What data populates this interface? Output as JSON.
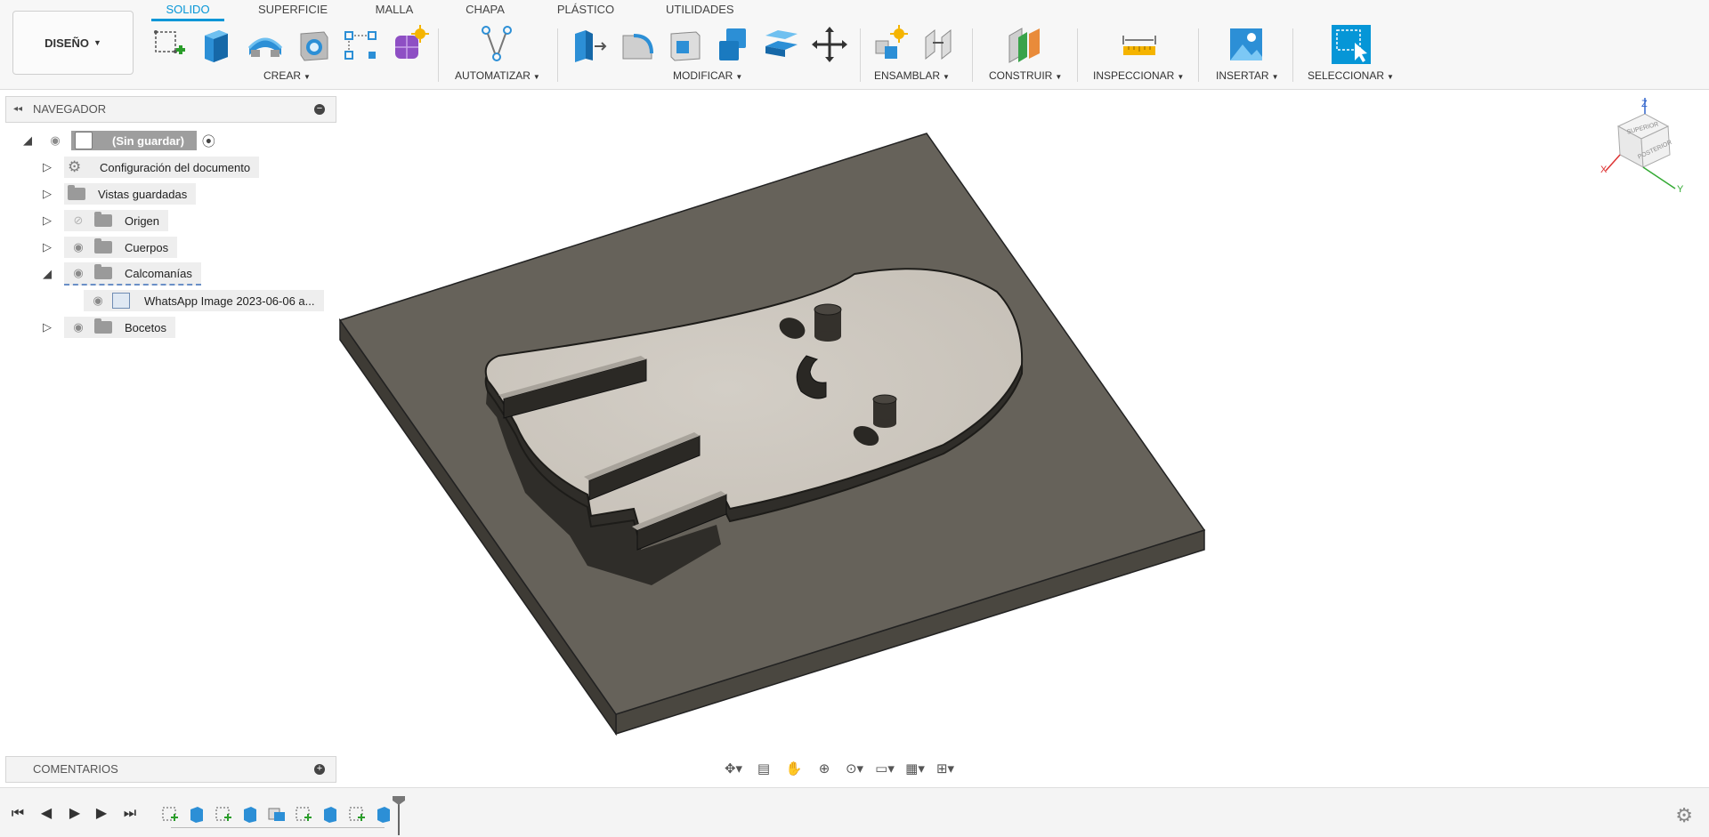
{
  "workspace": {
    "label": "DISEÑO"
  },
  "tabs": [
    {
      "label": "SOLIDO",
      "active": true
    },
    {
      "label": "SUPERFICIE",
      "active": false
    },
    {
      "label": "MALLA",
      "active": false
    },
    {
      "label": "CHAPA",
      "active": false
    },
    {
      "label": "PLÁSTICO",
      "active": false
    },
    {
      "label": "UTILIDADES",
      "active": false
    }
  ],
  "toolbar_groups": [
    {
      "label": "CREAR"
    },
    {
      "label": "AUTOMATIZAR"
    },
    {
      "label": "MODIFICAR"
    },
    {
      "label": "ENSAMBLAR"
    },
    {
      "label": "CONSTRUIR"
    },
    {
      "label": "INSPECCIONAR"
    },
    {
      "label": "INSERTAR"
    },
    {
      "label": "SELECCIONAR"
    }
  ],
  "navigator": {
    "title": "NAVEGADOR",
    "root": "(Sin guardar)",
    "items": [
      {
        "label": "Configuración del documento"
      },
      {
        "label": "Vistas guardadas"
      },
      {
        "label": "Origen"
      },
      {
        "label": "Cuerpos"
      },
      {
        "label": "Calcomanías"
      },
      {
        "label": "WhatsApp Image 2023-06-06 a..."
      },
      {
        "label": "Bocetos"
      }
    ]
  },
  "comments": {
    "title": "COMENTARIOS"
  },
  "viewcube": {
    "top_face": "SUPERIOR",
    "front_face": "POSTERIOR",
    "x_axis": "X",
    "y_axis": "Y",
    "z_axis": "Z"
  },
  "colors": {
    "accent": "#0696d7",
    "base_plate": "#66625a",
    "ghost_body": "#cdc8c0"
  }
}
